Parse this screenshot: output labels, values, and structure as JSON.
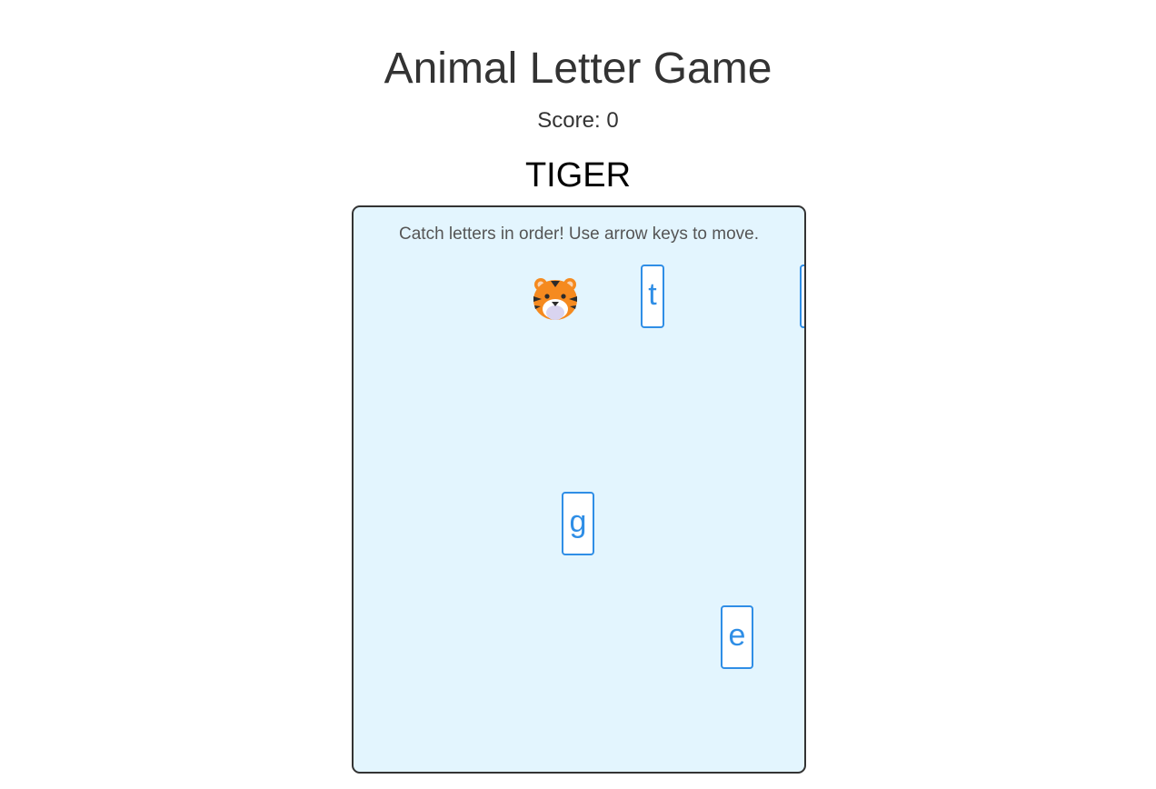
{
  "game": {
    "title": "Animal Letter Game",
    "score_text": "Score: 0",
    "target_word": "TIGER",
    "instructions": "Catch letters in order! Use arrow keys to move.",
    "player_icon": "tiger-face-icon",
    "falling_letters": [
      {
        "letter": "t"
      },
      {
        "letter": "g"
      },
      {
        "letter": "e"
      },
      {
        "letter": ""
      }
    ]
  },
  "colors": {
    "board_background": "#e3f5fe",
    "board_border": "#333333",
    "tile_accent": "#2f8ee6",
    "title_text": "#333333"
  }
}
